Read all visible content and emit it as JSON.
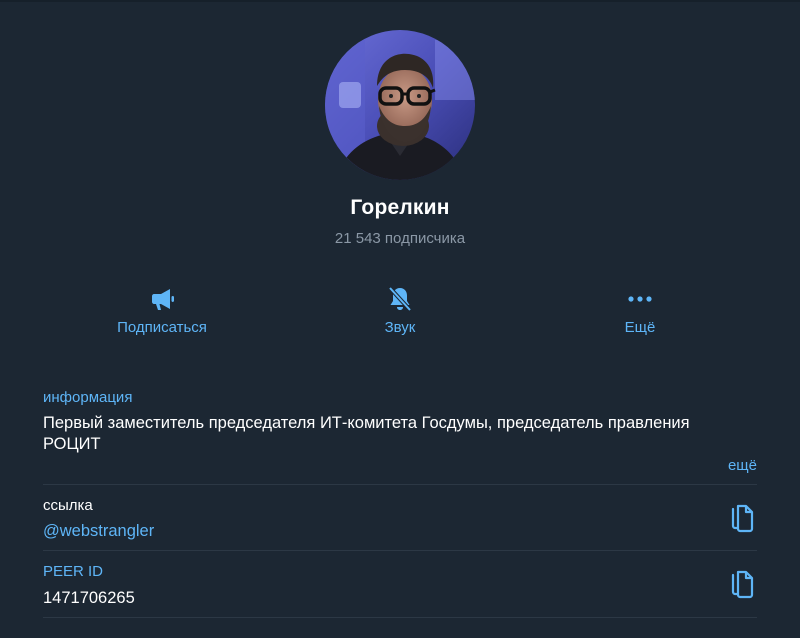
{
  "channel": {
    "name": "Горелкин",
    "subscribers": "21 543 подписчика"
  },
  "actions": {
    "subscribe_label": "Подписаться",
    "sound_label": "Звук",
    "more_label": "Ещё"
  },
  "info": {
    "title": "информация",
    "text": "Первый заместитель председателя ИТ-комитета Госдумы, председатель правления РОЦИТ",
    "more_link": "ещё"
  },
  "link": {
    "label": "ссылка",
    "value": "@webstrangler"
  },
  "peer": {
    "label": "PEER ID",
    "value": "1471706265"
  },
  "icons": {
    "subscribe": "megaphone-icon",
    "sound": "bell-muted-icon",
    "more": "more-dots-icon",
    "copy": "copy-icon"
  },
  "colors": {
    "background": "#1c2733",
    "accent": "#5eb5f7",
    "text_primary": "#ffffff",
    "text_secondary": "#8b98a6",
    "divider": "#2c3845"
  }
}
